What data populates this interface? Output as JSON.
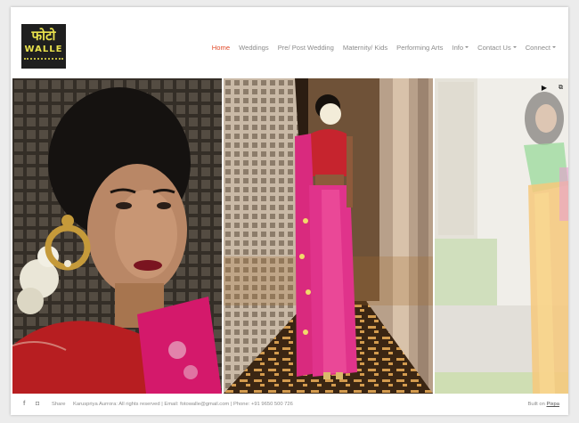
{
  "logo": {
    "devanagari": "फोटो",
    "latin": "WALLE"
  },
  "nav": {
    "items": [
      {
        "label": "Home",
        "active": true,
        "dropdown": false
      },
      {
        "label": "Weddings",
        "active": false,
        "dropdown": false
      },
      {
        "label": "Pre/ Post Wedding",
        "active": false,
        "dropdown": false
      },
      {
        "label": "Maternity/ Kids",
        "active": false,
        "dropdown": false
      },
      {
        "label": "Performing Arts",
        "active": false,
        "dropdown": false
      },
      {
        "label": "Info",
        "active": false,
        "dropdown": true
      },
      {
        "label": "Contact Us",
        "active": false,
        "dropdown": true
      },
      {
        "label": "Connect",
        "active": false,
        "dropdown": true
      }
    ],
    "active_color": "#e14b2a"
  },
  "slideshow": {
    "play_icon": "play-icon",
    "gallery_icon": "gallery-icon"
  },
  "footer": {
    "share_label": "Share",
    "info_text": "Karuspriya Aurrora: All rights reserved | Email: fotowalle@gmail.com | Phone: +91 9650 500 726",
    "built_on": "Built on",
    "built_link": "Pixpa"
  }
}
